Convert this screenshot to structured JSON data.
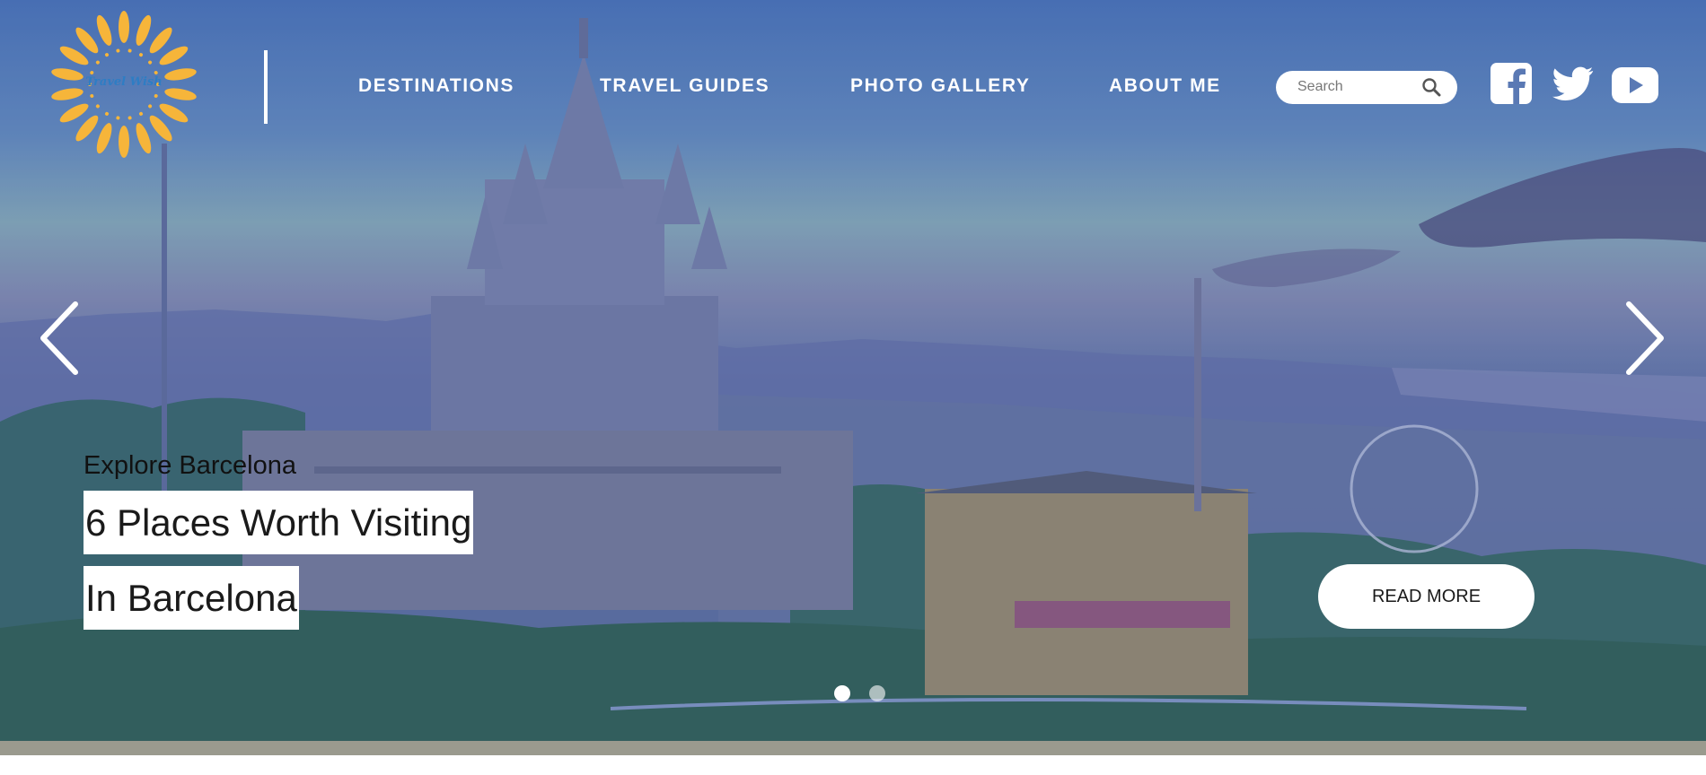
{
  "brand": {
    "name": "Travel Wish",
    "logo_color": "#f6b53a"
  },
  "nav": {
    "items": [
      {
        "label": "DESTINATIONS"
      },
      {
        "label": "TRAVEL GUIDES"
      },
      {
        "label": "PHOTO GALLERY"
      },
      {
        "label": "ABOUT ME"
      }
    ]
  },
  "search": {
    "placeholder": "Search",
    "icon": "search-icon"
  },
  "social": [
    {
      "name": "facebook",
      "icon": "facebook-icon"
    },
    {
      "name": "twitter",
      "icon": "twitter-icon"
    },
    {
      "name": "youtube",
      "icon": "youtube-icon"
    }
  ],
  "slider": {
    "kicker": "Explore Barcelona",
    "headline_line1": "6 Places Worth Visiting",
    "headline_line2": "In Barcelona",
    "cta_label": "READ MORE",
    "prev_icon": "chevron-left-icon",
    "next_icon": "chevron-right-icon",
    "slide_count": 2,
    "active_slide": 1
  }
}
